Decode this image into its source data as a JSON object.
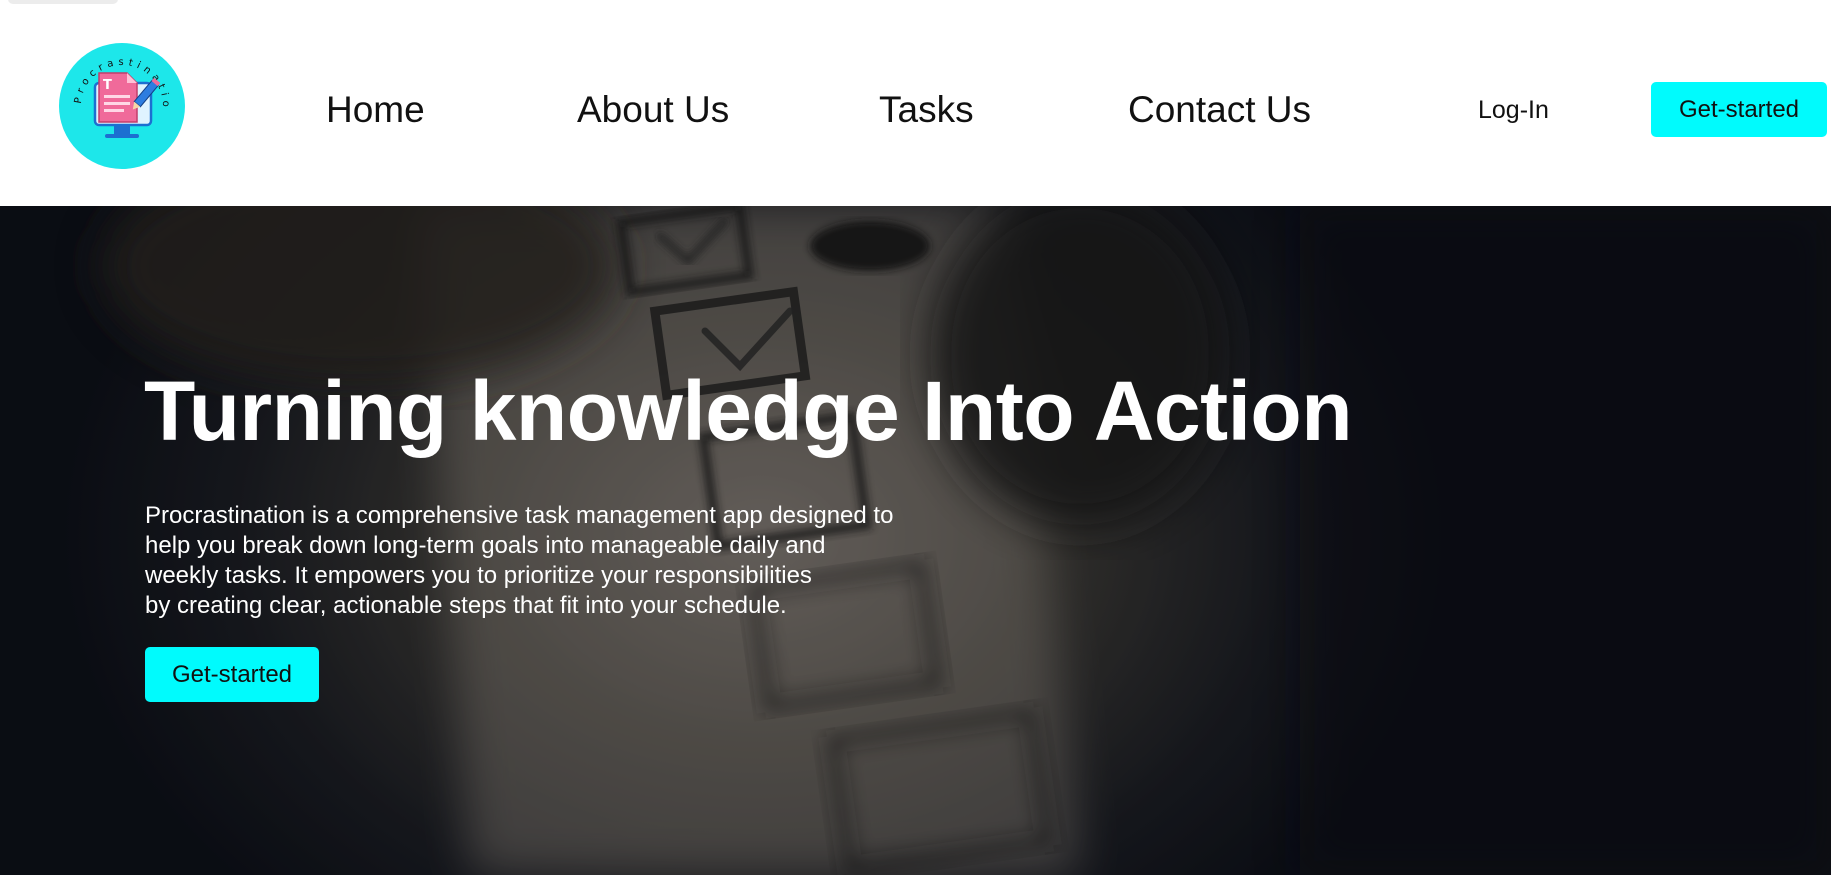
{
  "brand": {
    "logo_text": "Procrastination",
    "logo_icon": "monitor-document-pencil-icon",
    "accent_color": "#00fbfd"
  },
  "nav": {
    "items": [
      {
        "label": "Home"
      },
      {
        "label": "About Us"
      },
      {
        "label": "Tasks"
      },
      {
        "label": "Contact Us"
      }
    ],
    "login_label": "Log-In",
    "cta_label": "Get-started"
  },
  "hero": {
    "background_icon": "checklist-photo",
    "title": "Turning knowledge Into Action",
    "description_lines": [
      "Procrastination is a comprehensive task management app designed to",
      "help you break down long-term goals into manageable daily and",
      "weekly tasks. It empowers you to prioritize your responsibilities",
      "by creating clear, actionable steps that fit into your schedule."
    ],
    "cta_label": "Get-started"
  }
}
